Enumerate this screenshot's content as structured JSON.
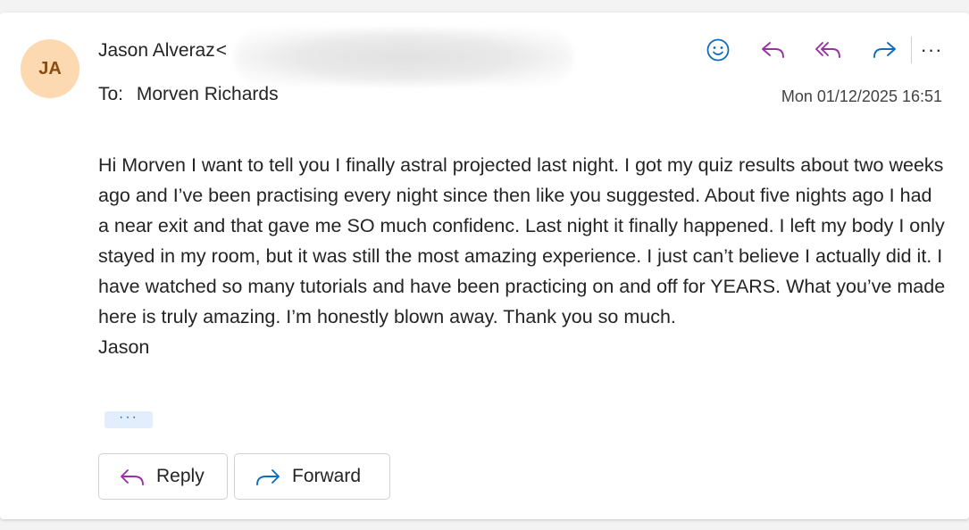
{
  "message": {
    "avatar_initials": "JA",
    "sender_name": "Jason Alveraz",
    "sender_email_open": "<",
    "to_label": "To:",
    "recipient": "Morven Richards",
    "date": "Mon 01/12/2025 16:51",
    "body": [
      "Hi Morven I want to tell you I finally astral projected last night. I got my quiz results about two weeks ago and I’ve been practising every night since then like you suggested. About five nights ago I had a near exit and that gave me SO much confidenc. Last night it finally happened. I left my body I only stayed in my room, but it was still the most amazing experience. I just can’t believe I actually did it. I have watched so many tutorials and have been practicing on and off for YEARS. What you’ve made here is truly amazing. I’m honestly blown away. Thank you so much.",
      "Jason"
    ],
    "show_trimmed": "···"
  },
  "toolbar": {
    "icons": [
      "emoji-icon",
      "reply-icon",
      "reply-all-icon",
      "forward-icon",
      "more-icon"
    ],
    "more_label": "···"
  },
  "buttons": {
    "reply_label": "Reply",
    "forward_label": "Forward"
  },
  "colors": {
    "avatar_bg": "#fcd9b0",
    "avatar_text": "#8a4b0f",
    "reply_purple": "#9a2fa6",
    "accent_blue": "#0f6cbd"
  }
}
